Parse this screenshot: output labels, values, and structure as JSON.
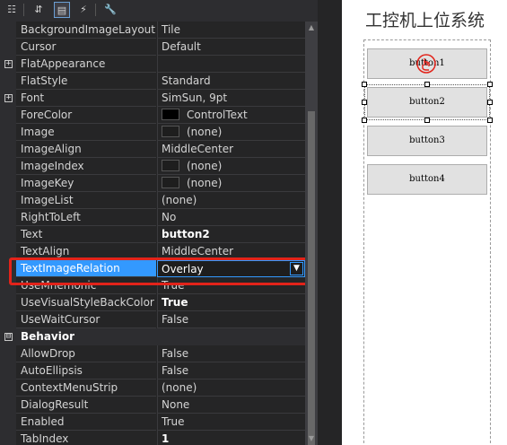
{
  "toolbar": {
    "buttons": [
      {
        "name": "categorized-icon",
        "glyph": "☷"
      },
      {
        "name": "alphabetical-icon",
        "glyph": "⇵"
      },
      {
        "name": "properties-icon",
        "glyph": "▤"
      },
      {
        "name": "events-icon",
        "glyph": "⚡"
      },
      {
        "name": "property-pages-icon",
        "glyph": "🔧"
      }
    ]
  },
  "rows": [
    {
      "name": "BackgroundImageLayout",
      "value": "Tile"
    },
    {
      "name": "Cursor",
      "value": "Default"
    },
    {
      "name": "FlatAppearance",
      "value": "",
      "expander": "+"
    },
    {
      "name": "FlatStyle",
      "value": "Standard"
    },
    {
      "name": "Font",
      "value": "SimSun, 9pt",
      "expander": "+"
    },
    {
      "name": "ForeColor",
      "value": "ControlText",
      "swatch": "#000000"
    },
    {
      "name": "Image",
      "value": "(none)",
      "swatch": "#1e1e1e"
    },
    {
      "name": "ImageAlign",
      "value": "MiddleCenter"
    },
    {
      "name": "ImageIndex",
      "value": "(none)",
      "swatch": "#1e1e1e"
    },
    {
      "name": "ImageKey",
      "value": "(none)",
      "swatch": "#1e1e1e"
    },
    {
      "name": "ImageList",
      "value": "(none)"
    },
    {
      "name": "RightToLeft",
      "value": "No"
    },
    {
      "name": "Text",
      "value": "button2",
      "bold": true
    },
    {
      "name": "TextAlign",
      "value": "MiddleCenter"
    },
    {
      "name": "TextImageRelation",
      "value": "Overlay",
      "selected": true
    },
    {
      "name": "UseMnemonic",
      "value": "True"
    },
    {
      "name": "UseVisualStyleBackColor",
      "value": "True",
      "bold": true
    },
    {
      "name": "UseWaitCursor",
      "value": "False"
    },
    {
      "category": true,
      "name": "Behavior",
      "expander": "⊟"
    },
    {
      "name": "AllowDrop",
      "value": "False"
    },
    {
      "name": "AutoEllipsis",
      "value": "False"
    },
    {
      "name": "ContextMenuStrip",
      "value": "(none)"
    },
    {
      "name": "DialogResult",
      "value": "None"
    },
    {
      "name": "Enabled",
      "value": "True"
    },
    {
      "name": "TabIndex",
      "value": "1",
      "bold": true
    }
  ],
  "designer": {
    "form_title": "工控机上位系统",
    "buttons": [
      "button1",
      "button2",
      "button3",
      "button4"
    ],
    "selected_index": 1
  },
  "colors": {
    "selection": "#3399ff",
    "highlight_box": "#e2231a"
  }
}
